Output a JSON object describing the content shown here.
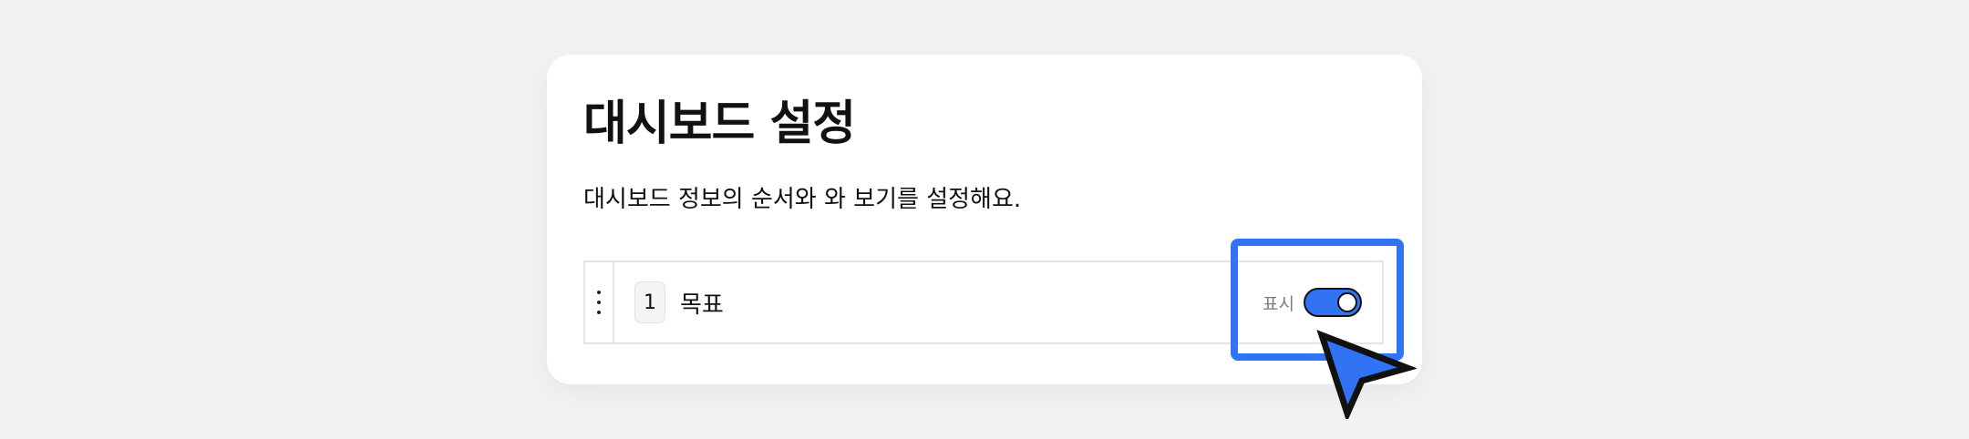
{
  "settings": {
    "title": "대시보드 설정",
    "subtitle": "대시보드 정보의 순서와 와 보기를 설정해요.",
    "items": [
      {
        "order": "1",
        "label": "목표",
        "toggle_label": "표시",
        "visible": true
      }
    ]
  },
  "colors": {
    "accent": "#3273f6",
    "background": "#f1f2f4",
    "card": "#ffffff"
  },
  "icons": {
    "drag": "drag-handle-icon",
    "cursor": "pointer-cursor-icon"
  }
}
